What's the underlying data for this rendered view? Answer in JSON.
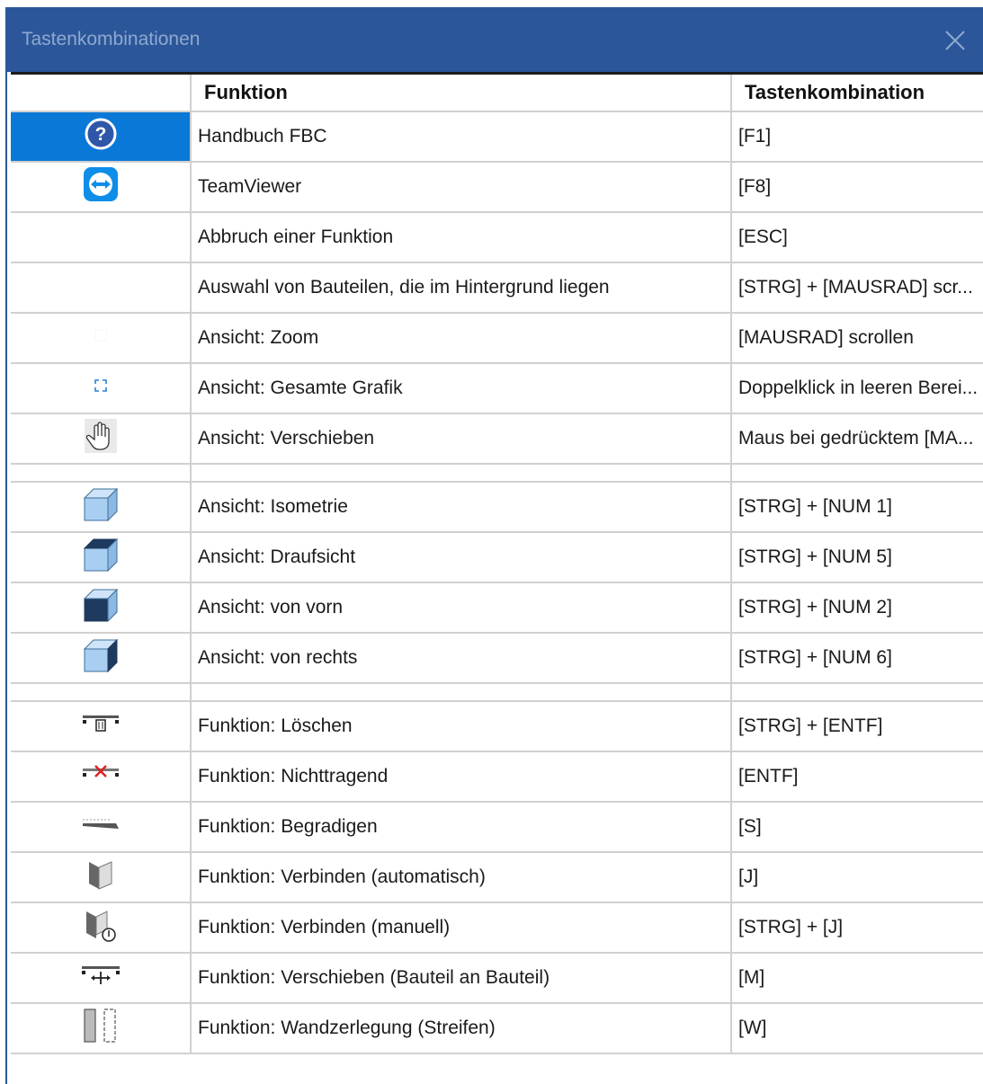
{
  "window": {
    "title": "Tastenkombinationen",
    "close_icon": "close-icon",
    "colors": {
      "titlebar": "#2b579a",
      "selection": "#0a78d7"
    }
  },
  "table": {
    "columns": [
      "",
      "Funktion",
      "Tastenkombination"
    ],
    "rows": [
      {
        "icon": "help-icon",
        "funktion": "Handbuch FBC",
        "taste": "[F1]",
        "selected": true
      },
      {
        "icon": "teamviewer-icon",
        "funktion": "TeamViewer",
        "taste": "[F8]"
      },
      {
        "icon": "",
        "funktion": "Abbruch einer Funktion",
        "taste": "[ESC]"
      },
      {
        "icon": "",
        "funktion": "Auswahl von Bauteilen, die im Hintergrund liegen",
        "taste": "[STRG] + [MAUSRAD] scr..."
      },
      {
        "icon": "zoom-icon",
        "funktion": "Ansicht: Zoom",
        "taste": "[MAUSRAD] scrollen"
      },
      {
        "icon": "zoom-extents-icon",
        "funktion": "Ansicht: Gesamte Grafik",
        "taste": "Doppelklick in leeren Berei..."
      },
      {
        "icon": "hand-pan-icon",
        "funktion": "Ansicht: Verschieben",
        "taste": "Maus bei gedrücktem [MA..."
      },
      {
        "spacer": true
      },
      {
        "icon": "cube-isometric-icon",
        "funktion": "Ansicht: Isometrie",
        "taste": "[STRG] + [NUM 1]"
      },
      {
        "icon": "cube-top-icon",
        "funktion": "Ansicht: Draufsicht",
        "taste": "[STRG] + [NUM 5]"
      },
      {
        "icon": "cube-front-icon",
        "funktion": "Ansicht: von vorn",
        "taste": "[STRG] + [NUM 2]"
      },
      {
        "icon": "cube-right-icon",
        "funktion": "Ansicht: von rechts",
        "taste": "[STRG] + [NUM 6]"
      },
      {
        "spacer": true
      },
      {
        "icon": "delete-icon",
        "funktion": "Funktion: Löschen",
        "taste": "[STRG] + [ENTF]"
      },
      {
        "icon": "non-bearing-icon",
        "funktion": "Funktion: Nichttragend",
        "taste": "[ENTF]"
      },
      {
        "icon": "straighten-icon",
        "funktion": "Funktion: Begradigen",
        "taste": "[S]"
      },
      {
        "icon": "connect-auto-icon",
        "funktion": "Funktion: Verbinden (automatisch)",
        "taste": "[J]"
      },
      {
        "icon": "connect-manual-icon",
        "funktion": "Funktion: Verbinden (manuell)",
        "taste": "[STRG] + [J]"
      },
      {
        "icon": "move-component-icon",
        "funktion": "Funktion: Verschieben (Bauteil an Bauteil)",
        "taste": "[M]"
      },
      {
        "icon": "wall-split-icon",
        "funktion": "Funktion: Wandzerlegung (Streifen)",
        "taste": "[W]"
      }
    ]
  }
}
